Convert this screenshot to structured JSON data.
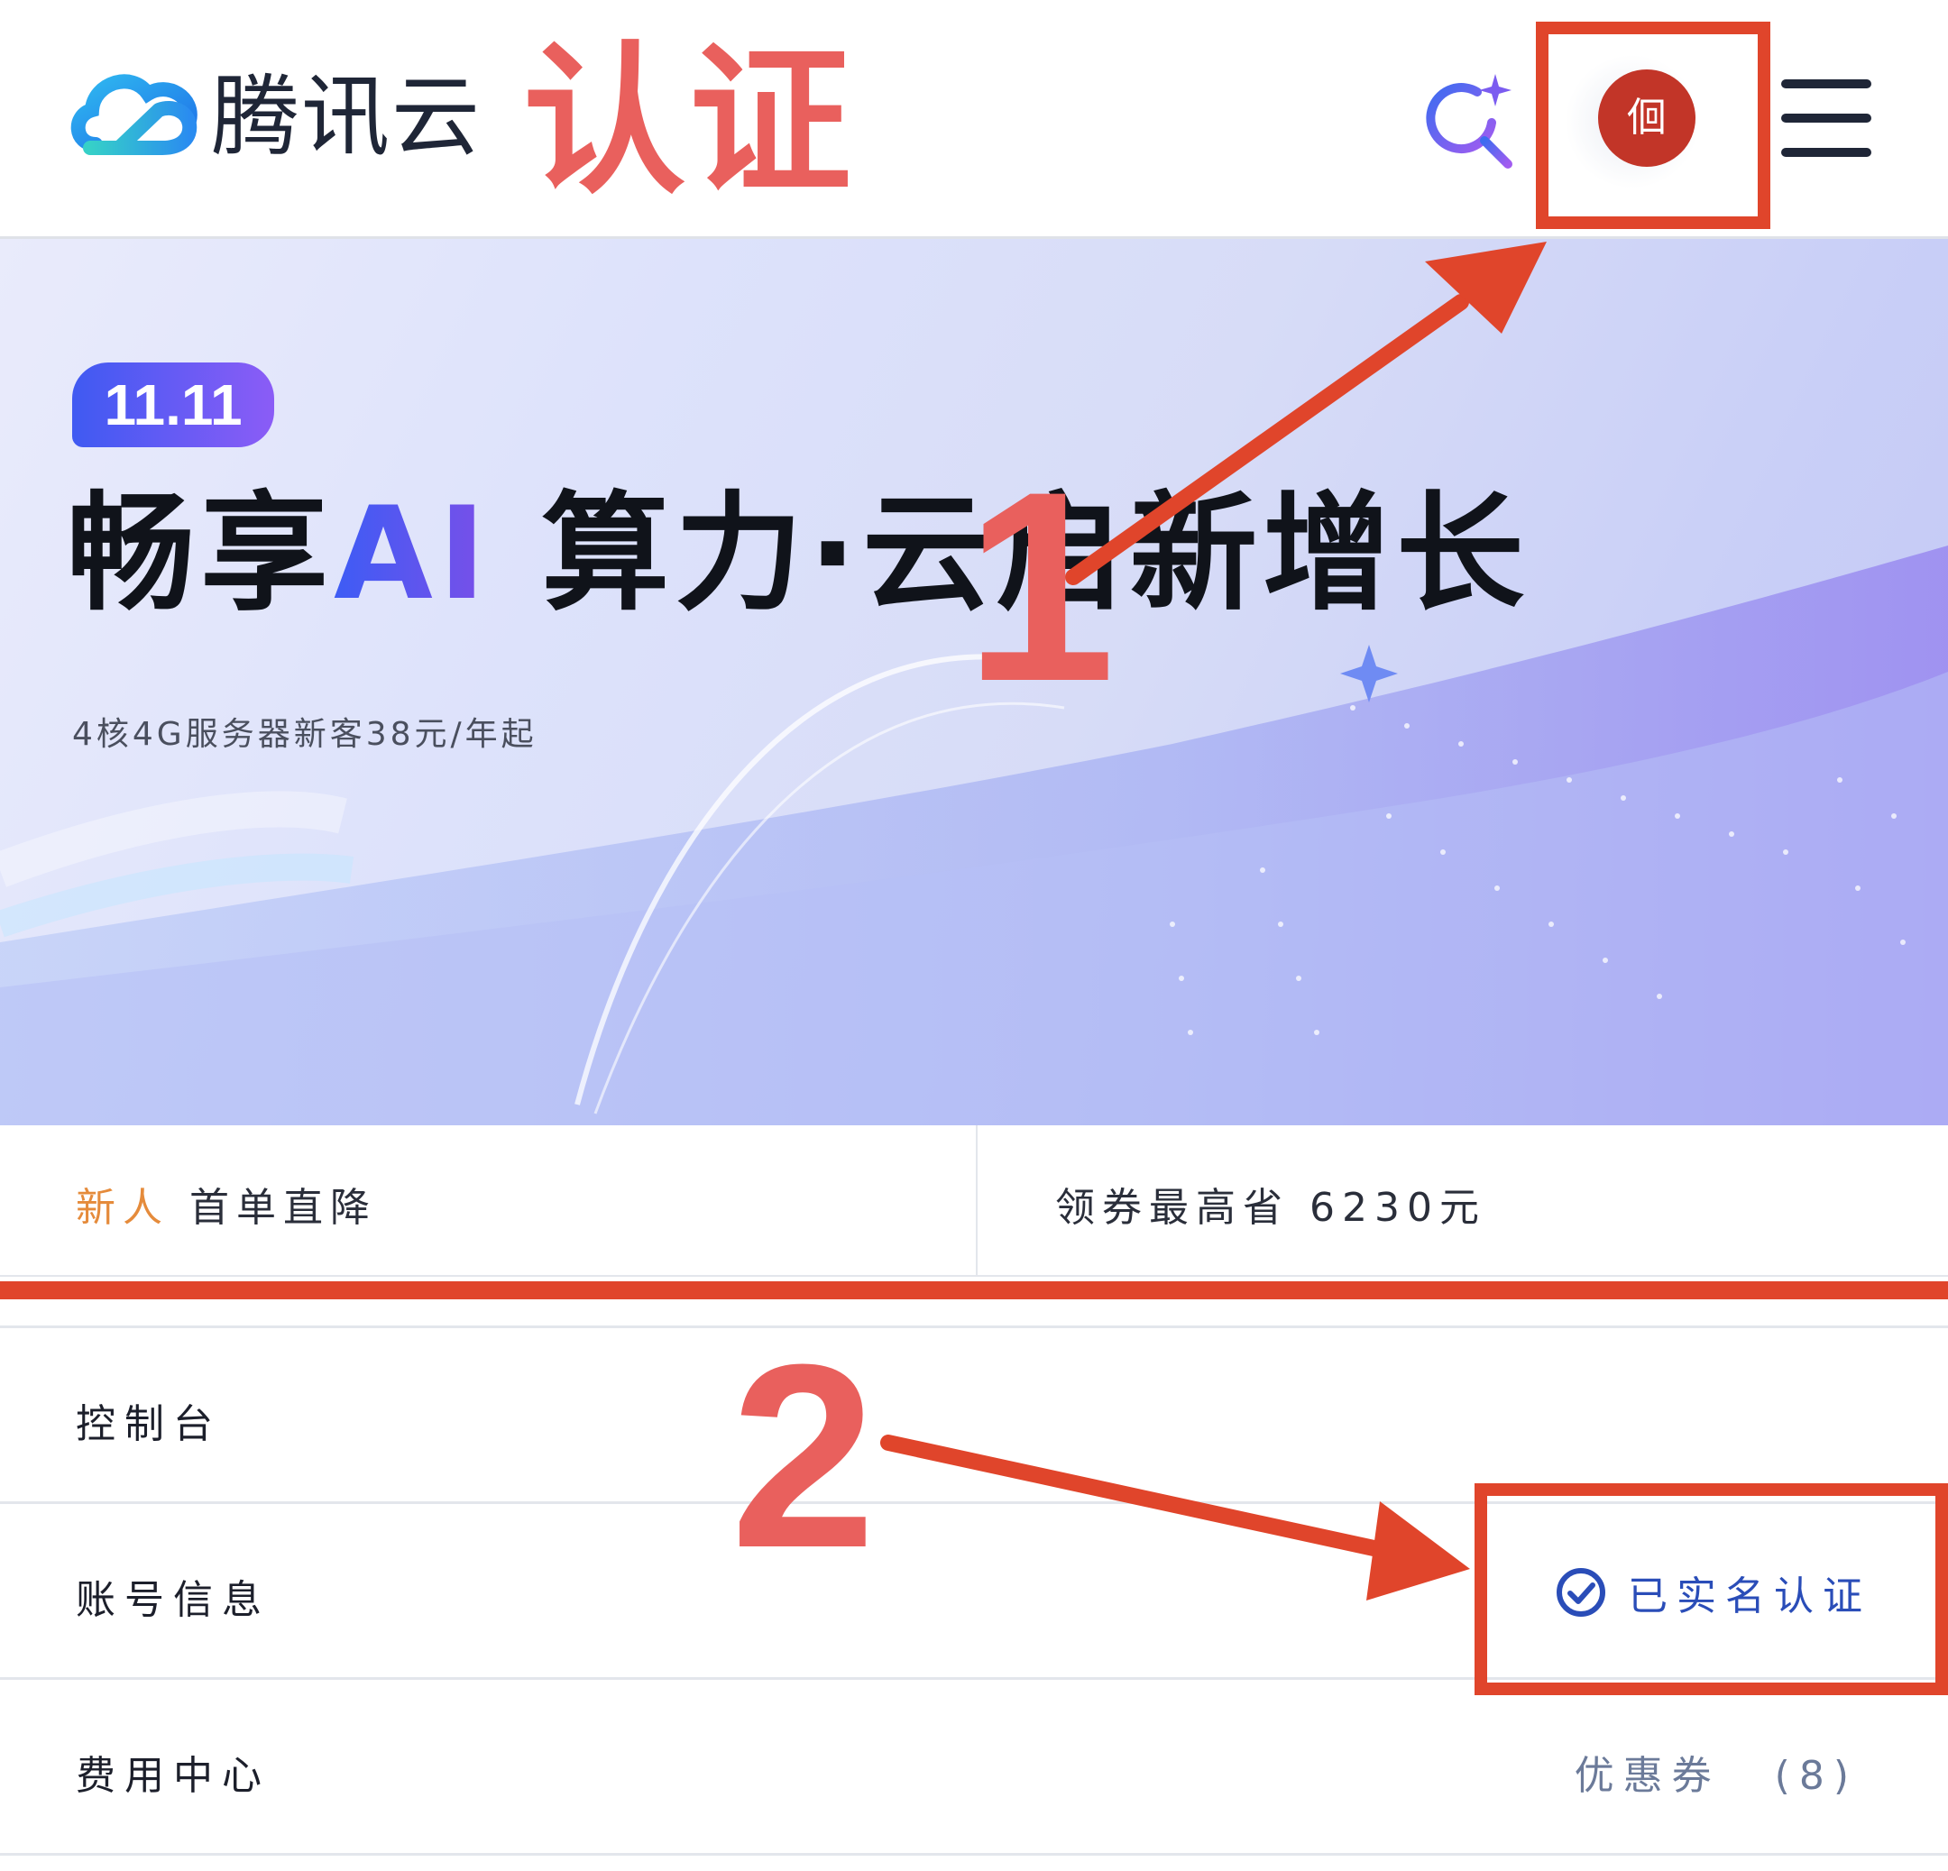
{
  "header": {
    "brand_name": "腾讯云",
    "overlay_title": "认证",
    "avatar_text": "佪"
  },
  "banner": {
    "badge": "11.11",
    "headline_part1": "畅享",
    "headline_ai": "AI",
    "headline_part2": " 算力·云启新增长",
    "subline": "4核4G服务器新客38元/年起"
  },
  "promo": {
    "left_tag": "新人",
    "left_text": "首单直降",
    "right_text": "领券最高省 6230元"
  },
  "menu": {
    "console": "控制台",
    "account_info": "账号信息",
    "verified_status": "已实名认证",
    "billing_center": "费用中心",
    "coupon_label": "优惠券",
    "coupon_count": "(8)"
  },
  "annotations": {
    "step1": "1",
    "step2": "2",
    "color": "#e0452b"
  },
  "icons": [
    "tencent-cloud-logo-icon",
    "ai-search-icon",
    "hamburger-menu-icon",
    "check-circle-icon",
    "sparkle-icon"
  ]
}
